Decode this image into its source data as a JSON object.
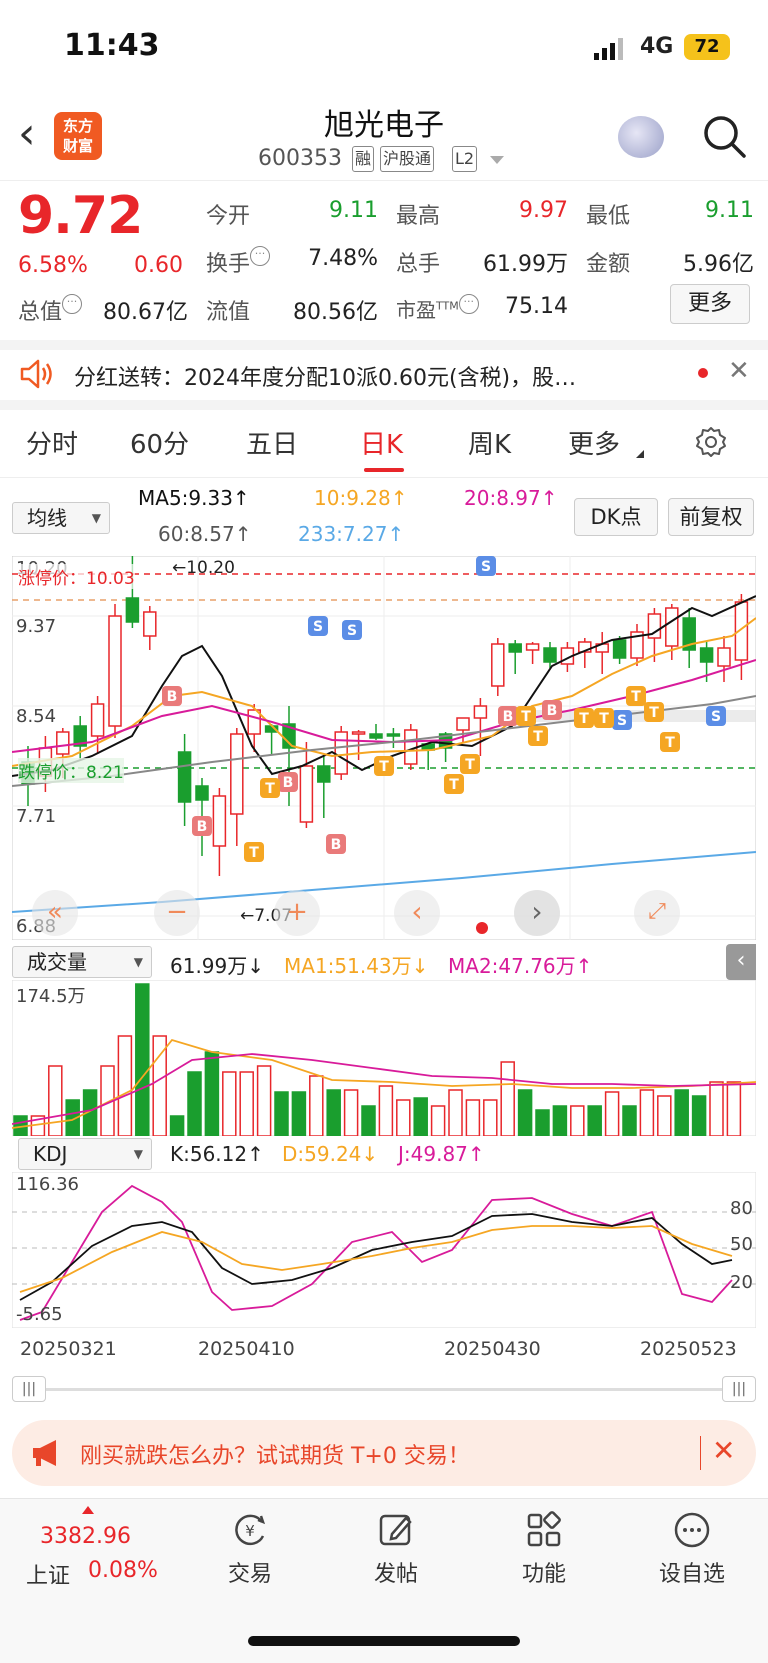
{
  "status": {
    "time": "11:43",
    "network": "4G",
    "battery": "72"
  },
  "header": {
    "logo_line1": "东方",
    "logo_line2": "财富",
    "name": "旭光电子",
    "code": "600353",
    "tags": [
      "融",
      "沪股通",
      "L2"
    ]
  },
  "quote": {
    "price": "9.72",
    "change_pct": "6.58%",
    "change_abs": "0.60",
    "open_label": "今开",
    "open": "9.11",
    "high_label": "最高",
    "high": "9.97",
    "low_label": "最低",
    "low": "9.11",
    "turnover_label": "换手",
    "turnover": "7.48%",
    "volume_label": "总手",
    "volume": "61.99万",
    "amount_label": "金额",
    "amount": "5.96亿",
    "mktcap_label": "总值",
    "mktcap": "80.67亿",
    "float_label": "流值",
    "float": "80.56亿",
    "pe_label": "市盈",
    "pe_sup": "TTM",
    "pe": "75.14",
    "more_label": "更多"
  },
  "dividend": {
    "text": "分红送转：2024年度分配10派0.60元(含税)，股…"
  },
  "tabs": [
    "分时",
    "60分",
    "五日",
    "日K",
    "周K",
    "更多"
  ],
  "ma_bar": {
    "selector": "均线",
    "ma5": "MA5:9.33↑",
    "ma10": "10:9.28↑",
    "ma20": "20:8.97↑",
    "ma60": "60:8.57↑",
    "ma233": "233:7.27↑",
    "dk_label": "DK点",
    "fq_label": "前复权"
  },
  "kline": {
    "y_labels": [
      "10.20",
      "9.37",
      "8.54",
      "7.71",
      "6.88"
    ],
    "limit_up": "涨停价：10.03",
    "limit_down": "跌停价：8.21",
    "high_mark": "←10.20",
    "low_mark": "←7.07"
  },
  "volume": {
    "selector": "成交量",
    "vol": "61.99万↓",
    "ma1": "MA1:51.43万↓",
    "ma2": "MA2:47.76万↑",
    "max_label": "174.5万"
  },
  "kdj": {
    "selector": "KDJ",
    "k": "K:56.12↑",
    "d": "D:59.24↓",
    "j": "J:49.87↑",
    "top_label": "116.36",
    "bottom_label": "-5.65",
    "levels": [
      "80",
      "50",
      "20"
    ]
  },
  "dates": [
    "20250321",
    "20250410",
    "20250430",
    "20250523"
  ],
  "promo": {
    "text": "刚买就跌怎么办？试试期货 T+0 交易！"
  },
  "bottom_nav": {
    "index_value": "3382.96",
    "index_name": "上证",
    "index_pct": "0.08%",
    "items": [
      "交易",
      "发帖",
      "功能",
      "设自选"
    ]
  },
  "colors": {
    "up": "#e8262a",
    "down": "#1a9e2e",
    "ma5": "#111111",
    "ma10": "#f5a623",
    "ma20": "#d81b9a",
    "ma60": "#888888",
    "ma233": "#5aa9e6"
  }
}
